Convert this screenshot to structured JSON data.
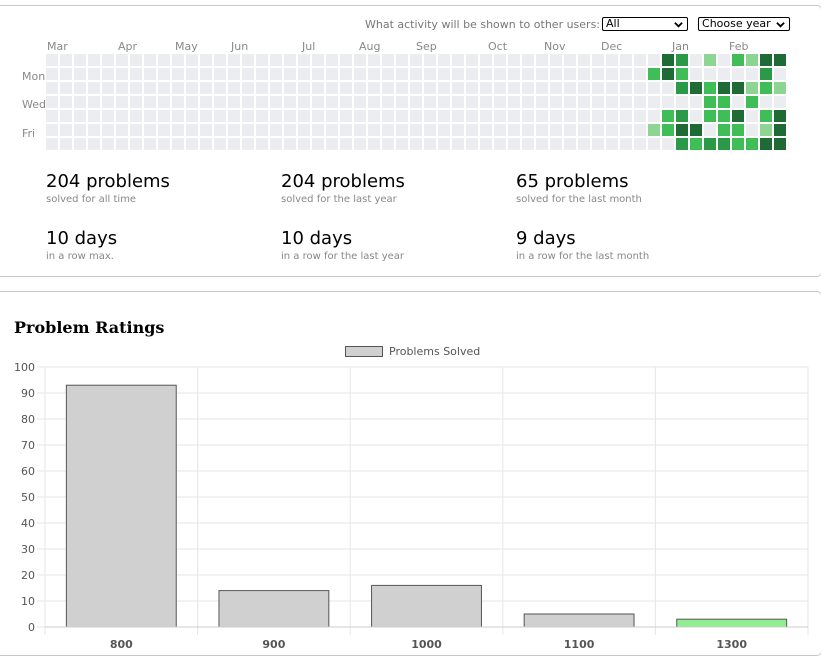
{
  "activity": {
    "visibility_label": "What activity will be shown to other users:",
    "visibility_selected": "All",
    "year_select": "Choose year",
    "months": [
      "Mar",
      "Apr",
      "May",
      "Jun",
      "Jul",
      "Aug",
      "Sep",
      "Oct",
      "Nov",
      "Dec",
      "Jan",
      "Feb"
    ],
    "days": [
      "Mon",
      "Wed",
      "Fri"
    ],
    "colors": {
      "empty": "#ebedf0",
      "l1": "#8ed493",
      "l2": "#3fbd57",
      "l3": "#2a9a48",
      "l4": "#1e6b35"
    },
    "stats": [
      {
        "num": "204 problems",
        "sub": "solved for all time"
      },
      {
        "num": "204 problems",
        "sub": "solved for the last year"
      },
      {
        "num": "65 problems",
        "sub": "solved for the last month"
      },
      {
        "num": "10 days",
        "sub": "in a row max."
      },
      {
        "num": "10 days",
        "sub": "in a row for the last year"
      },
      {
        "num": "9 days",
        "sub": "in a row for the last month"
      }
    ]
  },
  "ratings": {
    "title": "Problem Ratings"
  },
  "chart_data": {
    "type": "bar",
    "categories": [
      "800",
      "900",
      "1000",
      "1100",
      "1300"
    ],
    "series": [
      {
        "name": "Problems Solved",
        "values": [
          93,
          14,
          16,
          5,
          3
        ]
      }
    ],
    "bar_colors": [
      "#d0d0d0",
      "#d0d0d0",
      "#d0d0d0",
      "#d0d0d0",
      "#90ee90"
    ],
    "ylim": [
      0,
      100
    ],
    "yticks": [
      0,
      10,
      20,
      30,
      40,
      50,
      60,
      70,
      80,
      90,
      100
    ],
    "grid": true,
    "legend": "top-center"
  }
}
